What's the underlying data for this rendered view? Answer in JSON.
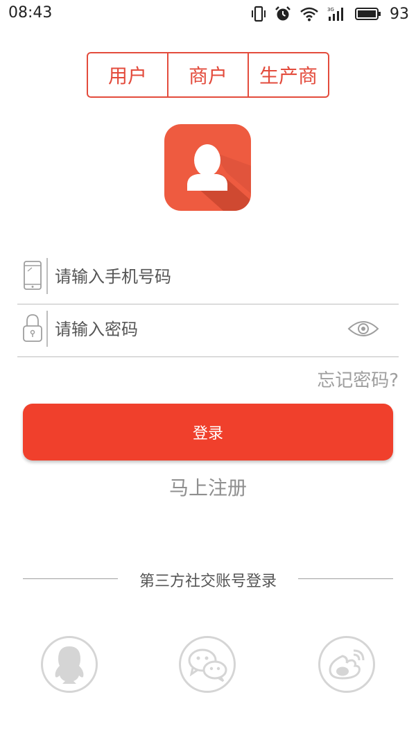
{
  "status_bar": {
    "time": "08:43",
    "battery": "93"
  },
  "tabs": [
    {
      "label": "用户"
    },
    {
      "label": "商户"
    },
    {
      "label": "生产商"
    }
  ],
  "form": {
    "phone_placeholder": "请输入手机号码",
    "password_placeholder": "请输入密码",
    "forgot_label": "忘记密码?",
    "login_label": "登录",
    "register_label": "马上注册"
  },
  "social": {
    "title": "第三方社交账号登录",
    "providers": [
      "qq-icon",
      "wechat-icon",
      "weibo-icon"
    ]
  },
  "colors": {
    "accent": "#f0402c",
    "tab": "#e34b3c",
    "muted": "#9e9e9e"
  }
}
